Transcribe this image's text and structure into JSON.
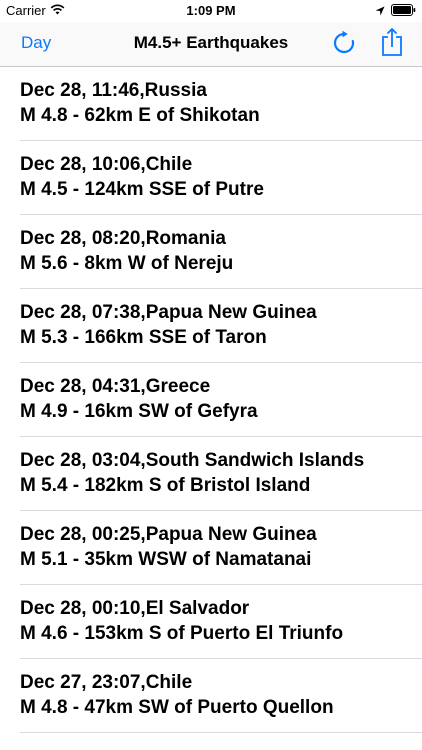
{
  "status_bar": {
    "carrier": "Carrier",
    "time": "1:09 PM",
    "icons": [
      "wifi-icon",
      "location-icon",
      "battery-icon"
    ]
  },
  "nav": {
    "left_button": "Day",
    "title": "M4.5+ Earthquakes",
    "right_icons": [
      "refresh-icon",
      "share-icon"
    ],
    "accent_color": "#0a7aff"
  },
  "quakes": [
    {
      "line1": "Dec 28, 11:46,Russia",
      "line2": "M 4.8 - 62km E of Shikotan"
    },
    {
      "line1": "Dec 28, 10:06,Chile",
      "line2": "M 4.5 - 124km SSE of Putre"
    },
    {
      "line1": "Dec 28, 08:20,Romania",
      "line2": "M 5.6 - 8km W of Nereju"
    },
    {
      "line1": "Dec 28, 07:38,Papua New Guinea",
      "line2": "M 5.3 - 166km SSE of Taron"
    },
    {
      "line1": "Dec 28, 04:31,Greece",
      "line2": "M 4.9 - 16km SW of Gefyra"
    },
    {
      "line1": "Dec 28, 03:04,South Sandwich Islands",
      "line2": "M 5.4 - 182km S of Bristol Island"
    },
    {
      "line1": "Dec 28, 00:25,Papua New Guinea",
      "line2": "M 5.1 - 35km WSW of Namatanai"
    },
    {
      "line1": "Dec 28, 00:10,El Salvador",
      "line2": "M 4.6 - 153km S of Puerto El Triunfo"
    },
    {
      "line1": "Dec 27, 23:07,Chile",
      "line2": "M 4.8 - 47km SW of Puerto Quellon"
    }
  ]
}
